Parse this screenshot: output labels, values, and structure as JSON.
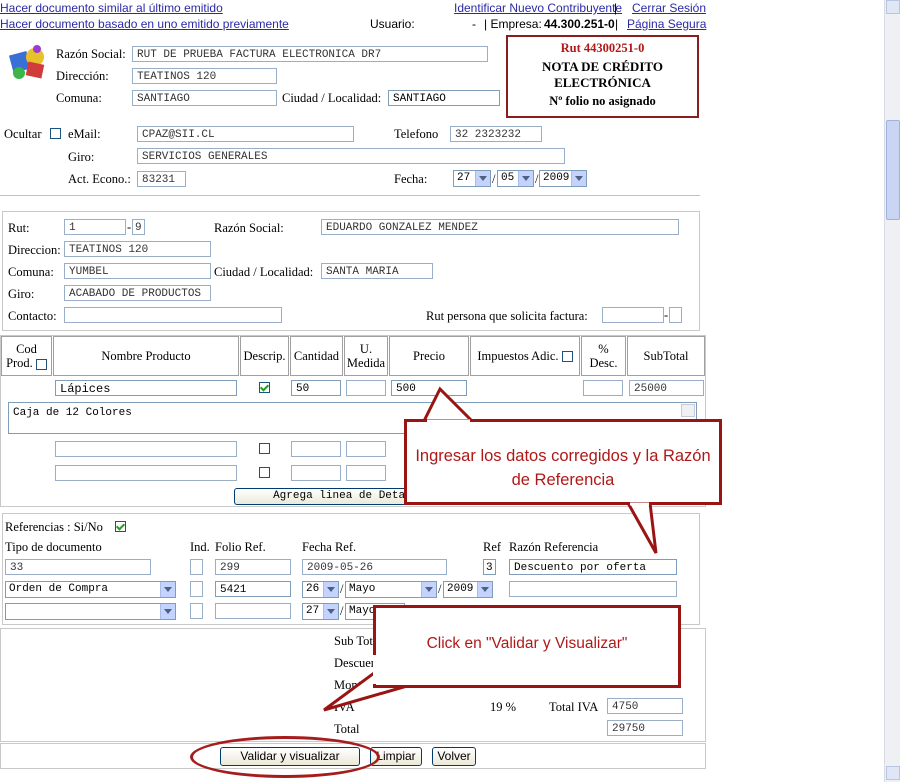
{
  "top": {
    "link1": "Hacer documento similar al último emitido",
    "link2": "Hacer documento basado en uno emitido previamente",
    "usuario_label": "Usuario:",
    "usuario_value": "-",
    "empresa_label": "| Empresa:",
    "empresa_value": "44.300.251-0",
    "sep1": "|",
    "sep2": "|",
    "identificar": "Identificar Nuevo Contribuyente",
    "cerrar": "Cerrar Sesión",
    "pagina_segura": "Página Segura"
  },
  "doc_box": {
    "rut": "Rut 44300251-0",
    "line1": "NOTA DE CRÉDITO",
    "line2": "ELECTRÓNICA",
    "folio": "Nº folio no asignado"
  },
  "emisor": {
    "razon_label": "Razón Social:",
    "razon_value": "RUT DE PRUEBA FACTURA ELECTRONICA DR7",
    "dir_label": "Dirección:",
    "dir_value": "TEATINOS 120",
    "comuna_label": "Comuna:",
    "comuna_value": "SANTIAGO",
    "ciudad_label": "Ciudad / Localidad:",
    "ciudad_value": "SANTIAGO",
    "ocultar_label": "Ocultar",
    "email_label": "eMail:",
    "email_value": "CPAZ@SII.CL",
    "tel_label": "Telefono",
    "tel_value": "32 2323232",
    "giro_label": "Giro:",
    "giro_value": "SERVICIOS GENERALES",
    "acteco_label": "Act. Econo.:",
    "acteco_value": "83231",
    "fecha_label": "Fecha:",
    "fecha_dia": "27",
    "fecha_mes": "05",
    "fecha_anio": "2009",
    "slash": "/"
  },
  "receptor": {
    "rut_label": "Rut:",
    "rut_value": "1",
    "dash": "-",
    "rut_dv": "9",
    "razon_label": "Razón Social:",
    "razon_value": "EDUARDO GONZALEZ MENDEZ",
    "dir_label": "Direccion:",
    "dir_value": "TEATINOS 120",
    "comuna_label": "Comuna:",
    "comuna_value": "YUMBEL",
    "ciudad_label": "Ciudad / Localidad:",
    "ciudad_value": "SANTA MARIA",
    "giro_label": "Giro:",
    "giro_value": "ACABADO DE PRODUCTOS",
    "contacto_label": "Contacto:",
    "contacto_value": "",
    "solicita_label": "Rut persona que solicita factura:",
    "solicita_value": "",
    "solicita_dv": ""
  },
  "detalle": {
    "headers": {
      "cod": "Cod",
      "prod": "Prod.",
      "nombre": "Nombre Producto",
      "descrip": "Descrip.",
      "cantidad": "Cantidad",
      "umedida_1": "U.",
      "umedida_2": "Medida",
      "precio": "Precio",
      "impuestos": "Impuestos Adic.",
      "desc_1": "%",
      "desc_2": "Desc.",
      "subtotal": "SubTotal"
    },
    "row1": {
      "nombre": "Lápices",
      "cantidad": "50",
      "precio": "500",
      "subtotal": "25000",
      "descripcion": "Caja de 12 Colores"
    },
    "agrega_button": "Agrega linea de Detalle"
  },
  "referencias": {
    "title": "Referencias : Si/No",
    "tipo_label": "Tipo de documento",
    "ind_label": "Ind.",
    "folio_label": "Folio Ref.",
    "fecha_label": "Fecha Ref.",
    "ref_label": "Ref",
    "razon_label": "Razón Referencia",
    "row1": {
      "tipo": "33",
      "folio": "299",
      "fecha": "2009-05-26",
      "ref": "3",
      "razon": "Descuento por oferta"
    },
    "row2": {
      "tipo": "Orden de Compra",
      "folio": "5421",
      "dia": "26",
      "mes": "Mayo",
      "anio": "2009"
    },
    "row3": {
      "dia": "27",
      "mes": "Mayo"
    }
  },
  "totales": {
    "subtotal_label": "Sub Total",
    "descuento_label": "Descuento",
    "monto_label": "Monto Neto",
    "iva_label": "IVA",
    "iva_pct": "19 %",
    "total_iva_label": "Total IVA",
    "total_iva_value": "4750",
    "total_label": "Total",
    "total_value": "29750"
  },
  "buttons": {
    "validar": "Validar y visualizar",
    "limpiar": "Limpiar",
    "volver": "Volver"
  },
  "callouts": {
    "c1": "Ingresar los datos corregidos y la Razón de Referencia",
    "c2": "Click en \"Validar y Visualizar\""
  },
  "colors": {
    "callout": "#9b1414",
    "link": "#2a2aa8"
  }
}
